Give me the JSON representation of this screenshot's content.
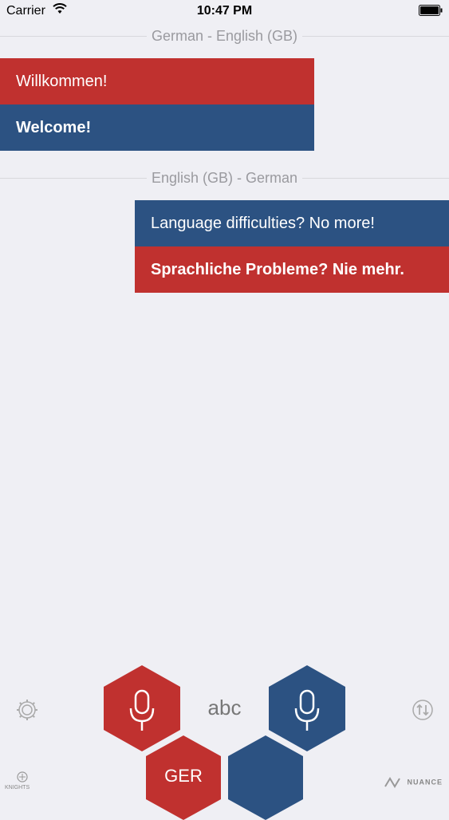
{
  "status_bar": {
    "carrier": "Carrier",
    "time": "10:47 PM"
  },
  "conversations": [
    {
      "direction_label": "German - English (GB)",
      "source_text": "Willkommen!",
      "translation_text": "Welcome!",
      "source_color": "#c0312f",
      "translation_color": "#2c5282"
    },
    {
      "direction_label": "English (GB) - German",
      "source_text": "Language difficulties? No more!",
      "translation_text": "Sprachliche Probleme? Nie mehr.",
      "source_color": "#2c5282",
      "translation_color": "#c0312f"
    }
  ],
  "controls": {
    "keyboard_label": "abc",
    "left_language_label": "GER",
    "settings_icon": "gear-icon",
    "swap_icon": "swap-icon",
    "left_mic_icon": "microphone-icon",
    "right_mic_icon": "microphone-icon"
  },
  "footer": {
    "left_brand": "KNIGHTS",
    "right_brand": "NUANCE"
  }
}
